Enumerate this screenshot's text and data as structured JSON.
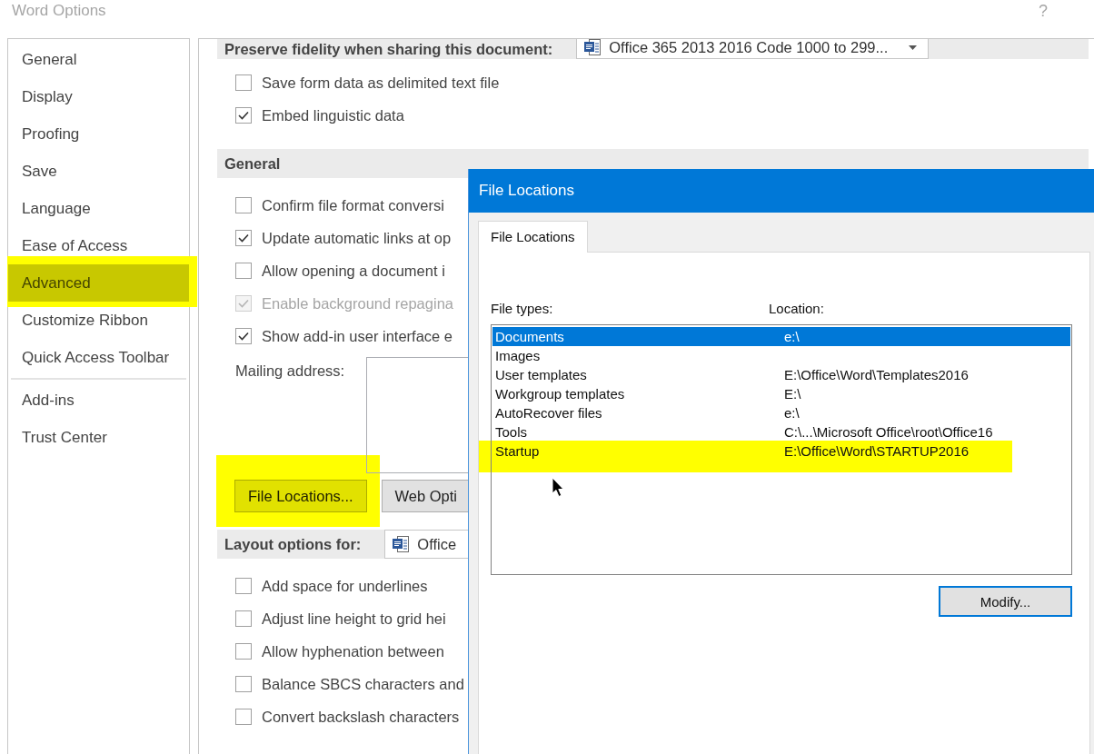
{
  "window": {
    "title": "Word Options",
    "help": "?"
  },
  "sidebar": {
    "groups": [
      {
        "items": [
          {
            "label": "General",
            "selected": false,
            "highlighted": false
          },
          {
            "label": "Display",
            "selected": false,
            "highlighted": false
          },
          {
            "label": "Proofing",
            "selected": false,
            "highlighted": false
          },
          {
            "label": "Save",
            "selected": false,
            "highlighted": false
          },
          {
            "label": "Language",
            "selected": false,
            "highlighted": false
          },
          {
            "label": "Ease of Access",
            "selected": false,
            "highlighted": false
          },
          {
            "label": "Advanced",
            "selected": true,
            "highlighted": true
          },
          {
            "label": "Customize Ribbon",
            "selected": false,
            "highlighted": false
          },
          {
            "label": "Quick Access Toolbar",
            "selected": false,
            "highlighted": false
          }
        ]
      },
      {
        "items": [
          {
            "label": "Add-ins",
            "selected": false,
            "highlighted": false
          },
          {
            "label": "Trust Center",
            "selected": false,
            "highlighted": false
          }
        ]
      }
    ]
  },
  "options": [
    {
      "kind": "header",
      "title": "Preserve fidelity when sharing this document:",
      "dropdown": "Office 365 2013 2016 Code 1000 to 299..."
    },
    {
      "kind": "checkbox",
      "label": "Save form data as delimited text file",
      "checked": false,
      "disabled": false
    },
    {
      "kind": "checkbox",
      "label": "Embed linguistic data",
      "checked": true,
      "disabled": false
    },
    {
      "kind": "header",
      "title": "General"
    },
    {
      "kind": "checkbox",
      "label": "Confirm file format conversi",
      "checked": false,
      "disabled": false
    },
    {
      "kind": "checkbox",
      "label": "Update automatic links at op",
      "checked": true,
      "disabled": false
    },
    {
      "kind": "checkbox",
      "label": "Allow opening a document i",
      "checked": false,
      "disabled": false
    },
    {
      "kind": "checkbox",
      "label": "Enable background repagina",
      "checked": true,
      "disabled": true
    },
    {
      "kind": "checkbox",
      "label": "Show add-in user interface e",
      "checked": true,
      "disabled": false
    },
    {
      "kind": "textarea",
      "label": "Mailing address:"
    },
    {
      "kind": "buttons",
      "buttons": [
        {
          "label": "File Locations...",
          "highlighted": true
        },
        {
          "label": "Web Opti",
          "highlighted": false
        }
      ]
    },
    {
      "kind": "header",
      "title": "Layout options for:",
      "dropdown": "Office"
    },
    {
      "kind": "checkbox",
      "label": "Add space for underlines",
      "checked": false,
      "disabled": false
    },
    {
      "kind": "checkbox",
      "label": "Adjust line height to grid hei",
      "checked": false,
      "disabled": false
    },
    {
      "kind": "checkbox",
      "label": "Allow hyphenation between",
      "checked": false,
      "disabled": false
    },
    {
      "kind": "checkbox",
      "label": "Balance SBCS characters and",
      "checked": false,
      "disabled": false
    },
    {
      "kind": "checkbox",
      "label": "Convert backslash characters",
      "checked": false,
      "disabled": false
    }
  ],
  "dialog": {
    "title": "File Locations",
    "tabs": [
      {
        "label": "File Locations",
        "selected": true
      }
    ],
    "columns": [
      "File types:",
      "Location:"
    ],
    "rows": [
      {
        "type": "Documents",
        "location": "e:\\",
        "selected": true,
        "highlighted": false
      },
      {
        "type": "Images",
        "selected": false,
        "highlighted": false
      },
      {
        "type": "User templates",
        "location": "E:\\Office\\Word\\Templates2016",
        "selected": false,
        "highlighted": false
      },
      {
        "type": "Workgroup templates",
        "location": "E:\\",
        "selected": false,
        "highlighted": false
      },
      {
        "type": "AutoRecover files",
        "location": "e:\\",
        "selected": false,
        "highlighted": false
      },
      {
        "type": "Tools",
        "location": "C:\\...\\Microsoft Office\\root\\Office16",
        "selected": false,
        "highlighted": false
      },
      {
        "type": "Startup",
        "location": "E:\\Office\\Word\\STARTUP2016",
        "selected": false,
        "highlighted": true
      }
    ],
    "buttons": [
      {
        "label": "Modify...",
        "default": true
      }
    ]
  }
}
